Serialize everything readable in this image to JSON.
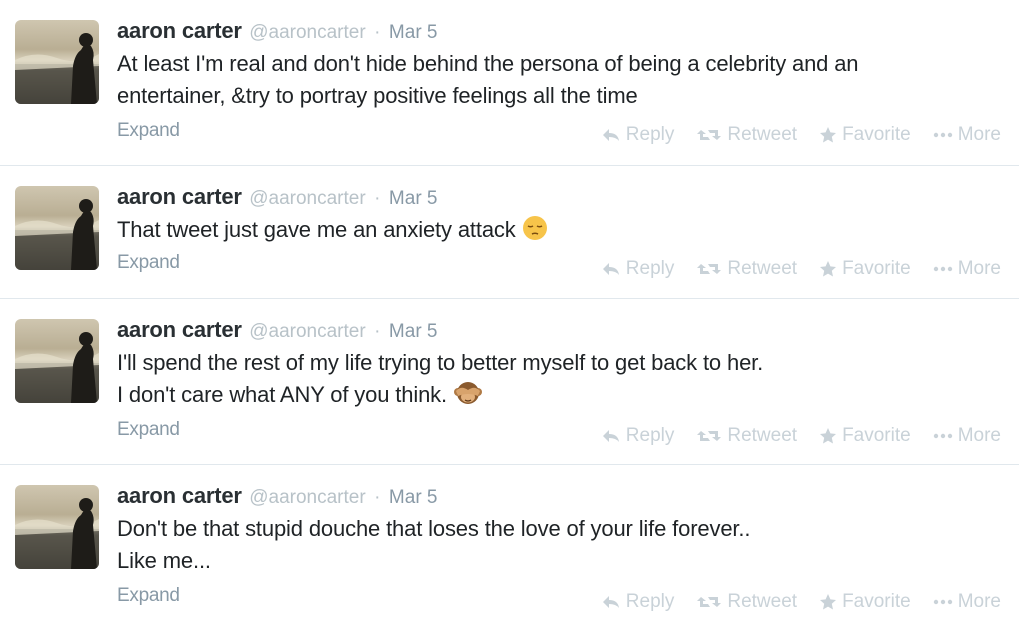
{
  "tweets": [
    {
      "fullname": "aaron carter",
      "username": "@aaroncarter",
      "separator": "·",
      "time": "Mar 5",
      "lines": [
        "At least I'm real and don't hide behind the persona of being a celebrity and an",
        "entertainer, &try to portray positive feelings all the time"
      ],
      "emoji": "",
      "expand": "Expand"
    },
    {
      "fullname": "aaron carter",
      "username": "@aaroncarter",
      "separator": "·",
      "time": "Mar 5",
      "lines": [
        "That tweet just gave me an anxiety attack"
      ],
      "emoji": "pensive-face-emoji",
      "expand": "Expand"
    },
    {
      "fullname": "aaron carter",
      "username": "@aaroncarter",
      "separator": "·",
      "time": "Mar 5",
      "lines": [
        "I'll spend the rest of my life trying to better myself to get back to her.",
        "I don't care what ANY of you think."
      ],
      "emoji": "see-no-evil-monkey-emoji",
      "expand": "Expand"
    },
    {
      "fullname": "aaron carter",
      "username": "@aaroncarter",
      "separator": "·",
      "time": "Mar 5",
      "lines": [
        "Don't be that stupid douche that loses the love of your life forever..",
        "Like me..."
      ],
      "emoji": "",
      "expand": "Expand"
    }
  ],
  "actions": {
    "reply": "Reply",
    "retweet": "Retweet",
    "favorite": "Favorite",
    "more": "More"
  },
  "icons": {
    "reply": "reply-arrow-icon",
    "retweet": "retweet-arrows-icon",
    "favorite": "star-icon",
    "more": "ellipsis-icon"
  },
  "colors": {
    "name": "#292f33",
    "meta": "#8899a6",
    "handle": "#b8c2c8",
    "action": "#c9d2d8",
    "divider": "#e1e8ed"
  }
}
